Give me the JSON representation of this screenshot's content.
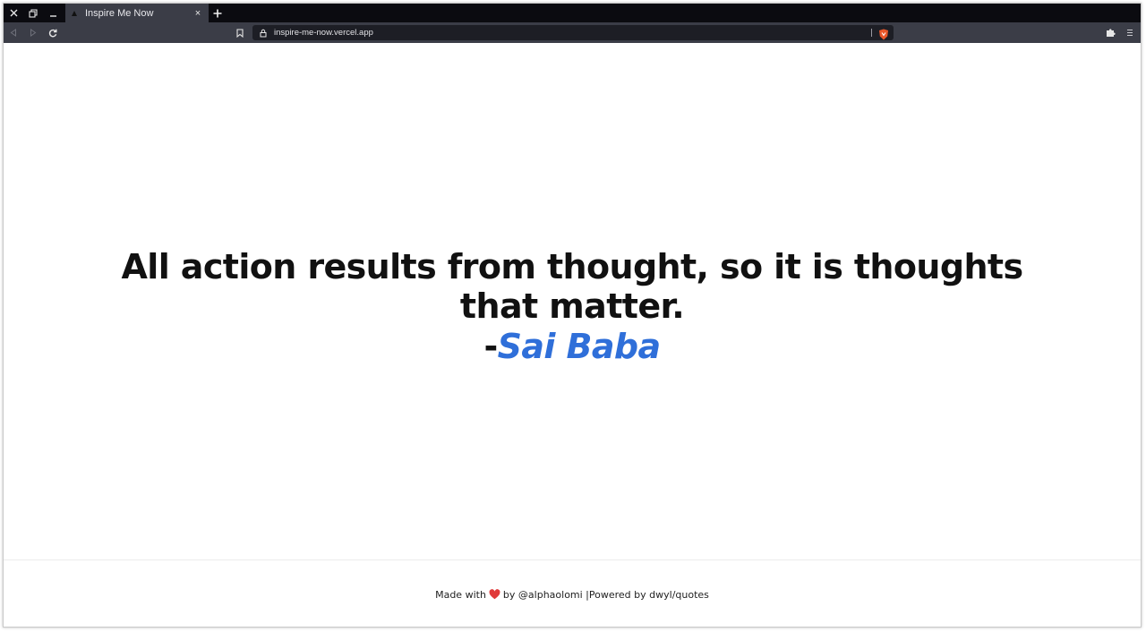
{
  "browser": {
    "tab_title": "Inspire Me Now",
    "url": "inspire-me-now.vercel.app",
    "tab_close_glyph": "×",
    "icons": {
      "close_window": "close-icon",
      "restore_window": "restore-icon",
      "minimize_window": "minimize-icon",
      "new_tab": "plus-icon",
      "back": "back-arrow-icon",
      "forward": "forward-arrow-icon",
      "reload": "reload-icon",
      "bookmark": "bookmark-icon",
      "lock": "lock-icon",
      "brave_shield": "brave-shield-icon",
      "extensions": "puzzle-icon",
      "menu": "hamburger-menu-icon"
    },
    "colors": {
      "tabstrip": "#0b0b10",
      "toolbar": "#3b3d47",
      "urlbar": "#1d1e25",
      "shield": "#e8572a"
    }
  },
  "page": {
    "quote": "All action results from thought, so it is thoughts that matter.",
    "author_prefix": "-",
    "author": "Sai Baba",
    "author_color": "#2f6fd9",
    "footer": {
      "made_with": "Made with",
      "heart_icon": "heart-icon",
      "by": "by @alphaolomi |Powered by dwyl/quotes"
    }
  }
}
